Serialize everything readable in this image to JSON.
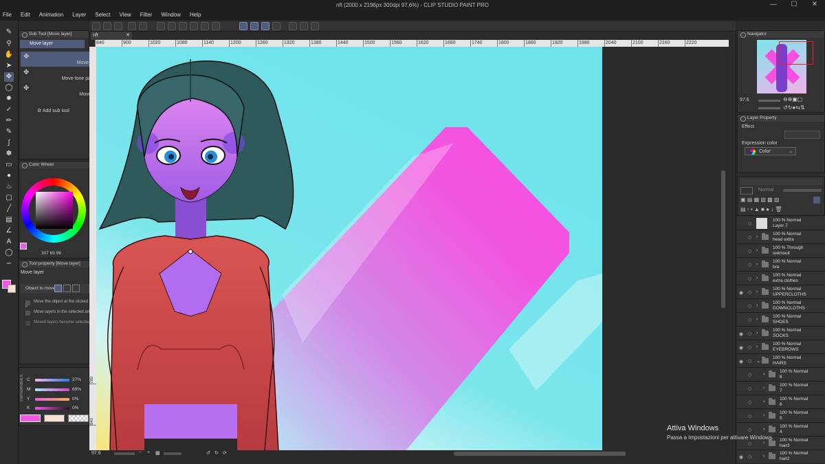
{
  "window": {
    "title": "nft (2000 x 2196px 300dpi 97.6%)  - CLIP STUDIO PAINT PRO",
    "controls": {
      "minimize": "—",
      "maximize": "☐",
      "close": "✕"
    }
  },
  "menu": [
    "File",
    "Edit",
    "Animation",
    "Layer",
    "Select",
    "View",
    "Filter",
    "Window",
    "Help"
  ],
  "sub_tool_panel": {
    "title": "Sub Tool [Move layer]",
    "tab": "Move layer",
    "items": [
      "Move layer",
      "Move tone pattern",
      "Move grid"
    ],
    "add": "Add sub tool"
  },
  "color_wheel": {
    "title": "Color Wheel",
    "values": {
      "h": "307",
      "s": "65",
      "v": "96"
    }
  },
  "tool_property": {
    "title": "Tool property [Move layer]",
    "heading": "Move layer",
    "object_to_move": "Object to move",
    "options": [
      "Move the object at the clicked p",
      "Move layers in the selected area",
      "Moved layers become selected"
    ]
  },
  "color_slider": {
    "mode_labels": [
      "HLS",
      "RGB",
      "CMYK"
    ],
    "channels": [
      {
        "label": "C",
        "value": "27%"
      },
      {
        "label": "M",
        "value": "69%"
      },
      {
        "label": "Y",
        "value": "0%"
      },
      {
        "label": "K",
        "value": "0%"
      }
    ]
  },
  "colors": {
    "main": "#f25ae6",
    "sub": "#fde0d6",
    "accent": "#4e5b7a",
    "canvas_bg": "#72e4ea",
    "shape_pink": "#f74fdf"
  },
  "document": {
    "tab": "nft",
    "ruler_top": [
      "840",
      "900",
      "1020",
      "1080",
      "1140",
      "1200",
      "1260",
      "1320",
      "1380",
      "1440",
      "1500",
      "1560",
      "1620",
      "1680",
      "1740",
      "1800",
      "1860",
      "1920",
      "1980",
      "2040",
      "2100",
      "2160",
      "2220"
    ],
    "ruler_left": [
      "780",
      "840",
      "900"
    ],
    "zoom": "97.6"
  },
  "navigator": {
    "title": "Navigator",
    "zoom": "97.6"
  },
  "layer_property": {
    "title": "Layer Property",
    "effect": "Effect",
    "expression_color": "Expression color",
    "color_value": "Color"
  },
  "layers": {
    "blend": "Normal",
    "items": [
      {
        "mode": "100 % Normal",
        "name": "Layer 7",
        "visible": false,
        "folder": false,
        "indent": 0
      },
      {
        "mode": "100 % Normal",
        "name": "head extra",
        "visible": false,
        "folder": true,
        "indent": 0
      },
      {
        "mode": "100 % Through",
        "name": "swimsuit",
        "visible": false,
        "folder": true,
        "indent": 0
      },
      {
        "mode": "100 % Normal",
        "name": "bra",
        "visible": false,
        "folder": true,
        "indent": 0
      },
      {
        "mode": "100 % Normal",
        "name": "extra clothes",
        "visible": false,
        "folder": true,
        "indent": 0
      },
      {
        "mode": "100 % Normal",
        "name": "UPPERCLOTHS",
        "visible": true,
        "folder": true,
        "indent": 0
      },
      {
        "mode": "100 % Normal",
        "name": "DOWNCLOTHS",
        "visible": false,
        "folder": true,
        "indent": 0
      },
      {
        "mode": "100 % Normal",
        "name": "SHOES",
        "visible": false,
        "folder": true,
        "indent": 0
      },
      {
        "mode": "100 % Normal",
        "name": "SOCKS",
        "visible": true,
        "folder": true,
        "indent": 0
      },
      {
        "mode": "100 % Normal",
        "name": "EYEBROWS",
        "visible": true,
        "folder": true,
        "indent": 0
      },
      {
        "mode": "100 % Normal",
        "name": "HAIRS",
        "visible": true,
        "folder": true,
        "indent": 0
      },
      {
        "mode": "100 % Normal",
        "name": "8",
        "visible": false,
        "folder": true,
        "indent": 1
      },
      {
        "mode": "100 % Normal",
        "name": "7",
        "visible": false,
        "folder": true,
        "indent": 1
      },
      {
        "mode": "100 % Normal",
        "name": "6",
        "visible": false,
        "folder": true,
        "indent": 1
      },
      {
        "mode": "100 % Normal",
        "name": "5",
        "visible": false,
        "folder": true,
        "indent": 1
      },
      {
        "mode": "100 % Normal",
        "name": "4",
        "visible": false,
        "folder": true,
        "indent": 1
      },
      {
        "mode": "100 % Normal",
        "name": "hair3",
        "visible": false,
        "folder": true,
        "indent": 1
      },
      {
        "mode": "100 % Normal",
        "name": "hair2",
        "visible": true,
        "folder": true,
        "indent": 1
      }
    ]
  },
  "activation": {
    "title": "Attiva Windows",
    "subtitle": "Passa a Impostazioni per attivare Windows."
  }
}
